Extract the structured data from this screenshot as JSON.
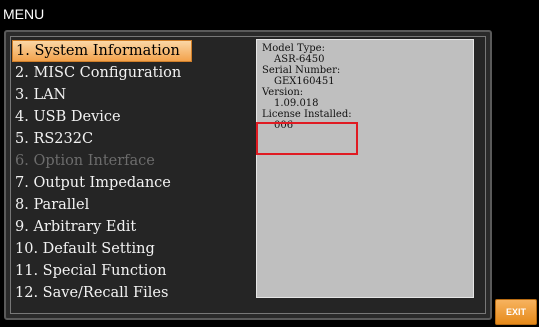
{
  "window": {
    "title": "MENU"
  },
  "menu": {
    "items": [
      {
        "label": "1. System Information",
        "state": "selected"
      },
      {
        "label": "2. MISC Configuration",
        "state": "normal"
      },
      {
        "label": "3. LAN",
        "state": "normal"
      },
      {
        "label": "4. USB Device",
        "state": "normal"
      },
      {
        "label": "5. RS232C",
        "state": "normal"
      },
      {
        "label": "6. Option Interface",
        "state": "disabled"
      },
      {
        "label": "7. Output Impedance",
        "state": "normal"
      },
      {
        "label": "8. Parallel",
        "state": "normal"
      },
      {
        "label": "9. Arbitrary Edit",
        "state": "normal"
      },
      {
        "label": "10. Default Setting",
        "state": "normal"
      },
      {
        "label": "11. Special Function",
        "state": "normal"
      },
      {
        "label": "12. Save/Recall Files",
        "state": "normal"
      }
    ]
  },
  "system_info": {
    "model_type_label": "Model Type:",
    "model_type": "ASR-6450",
    "serial_number_label": "Serial Number:",
    "serial_number": "GEX160451",
    "version_label": "Version:",
    "version": "1.09.018",
    "license_label": "License Installed:",
    "license": "006"
  },
  "softkeys": {
    "exit_label": "EXIT"
  },
  "colors": {
    "selected_highlight": "#f3a24c",
    "annotation_box": "#e01b22",
    "info_panel": "#bfbfbf"
  }
}
